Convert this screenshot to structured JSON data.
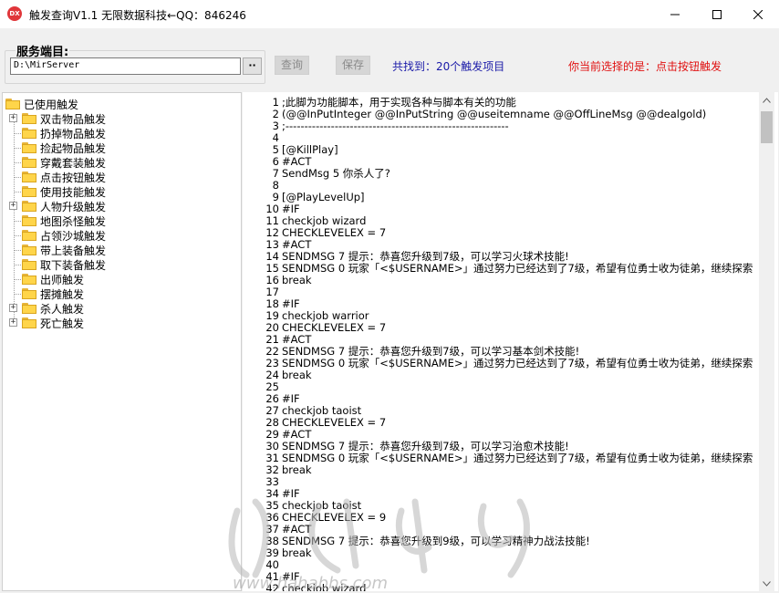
{
  "window": {
    "title": "触发查询V1.1 无限数据科技←QQ：846246",
    "icon_label": "DX"
  },
  "toolbar": {
    "group_label": "服务端目:",
    "path_value": "D:\\MirServer",
    "browse_label": "··",
    "query_label": "查询",
    "save_label": "保存",
    "found_text": "共找到：20个触发项目",
    "selected_text": "你当前选择的是：点击按钮触发"
  },
  "tree": {
    "root": "已使用触发",
    "items": [
      {
        "label": "双击物品触发",
        "expandable": true
      },
      {
        "label": "扔掉物品触发",
        "expandable": false
      },
      {
        "label": "捡起物品触发",
        "expandable": false
      },
      {
        "label": "穿戴套装触发",
        "expandable": false
      },
      {
        "label": "点击按钮触发",
        "expandable": false
      },
      {
        "label": "使用技能触发",
        "expandable": false
      },
      {
        "label": "人物升级触发",
        "expandable": true
      },
      {
        "label": "地图杀怪触发",
        "expandable": false
      },
      {
        "label": "占领沙城触发",
        "expandable": false
      },
      {
        "label": "带上装备触发",
        "expandable": false
      },
      {
        "label": "取下装备触发",
        "expandable": false
      },
      {
        "label": "出师触发",
        "expandable": false
      },
      {
        "label": "摆摊触发",
        "expandable": false
      },
      {
        "label": "杀人触发",
        "expandable": true
      },
      {
        "label": "死亡触发",
        "expandable": true
      }
    ]
  },
  "code": {
    "lines": [
      ";此脚为功能脚本，用于实现各种与脚本有关的功能",
      "(@@InPutInteger @@InPutString @@useitemname @@OffLineMsg @@dealgold)",
      ";-----------------------------------------------------------",
      "",
      "[@KillPlay]",
      "#ACT",
      "SendMsg 5 你杀人了?",
      "",
      "[@PlayLevelUp]",
      "#IF",
      "checkjob wizard",
      "CHECKLEVELEX = 7",
      "#ACT",
      "SENDMSG 7 提示：恭喜您升级到7级，可以学习火球术技能!",
      "SENDMSG 0 玩家「<$USERNAME>」通过努力已经达到了7级，希望有位勇士收为徒弟，继续探索",
      "break",
      "",
      "#IF",
      "checkjob warrior",
      "CHECKLEVELEX = 7",
      "#ACT",
      "SENDMSG 7 提示：恭喜您升级到7级，可以学习基本剑术技能!",
      "SENDMSG 0 玩家「<$USERNAME>」通过努力已经达到了7级，希望有位勇士收为徒弟，继续探索",
      "break",
      "",
      "#IF",
      "checkjob taoist",
      "CHECKLEVELEX = 7",
      "#ACT",
      "SENDMSG 7 提示：恭喜您升级到7级，可以学习治愈术技能!",
      "SENDMSG 0 玩家「<$USERNAME>」通过努力已经达到了7级，希望有位勇士收为徒弟，继续探索",
      "break",
      "",
      "#IF",
      "checkjob taoist",
      "CHECKLEVELEX = 9",
      "#ACT",
      "SENDMSG 7 提示：恭喜您升级到9级，可以学习精神力战法技能!",
      "break",
      "",
      "#IF",
      "checkjob wizard"
    ]
  },
  "watermark": {
    "url_text": "www.hahabbs.com"
  },
  "colors": {
    "found_text": "#1a1aa8",
    "selected_text": "#e01010",
    "folder": "#ffd54a"
  }
}
